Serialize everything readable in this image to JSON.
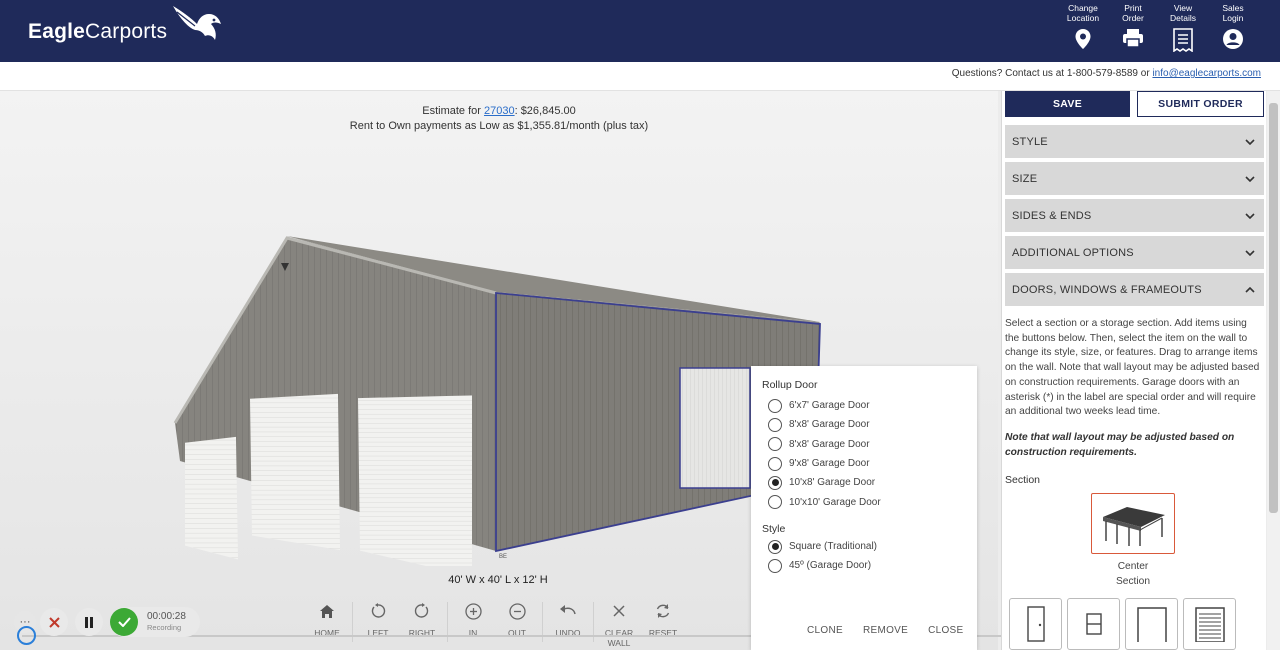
{
  "header": {
    "logo_text_bold": "Eagle",
    "logo_text": "Carports",
    "actions": [
      {
        "label": "Change\nLocation",
        "icon": "location-pin-icon"
      },
      {
        "label": "Print\nOrder",
        "icon": "printer-icon"
      },
      {
        "label": "View\nDetails",
        "icon": "receipt-icon"
      },
      {
        "label": "Sales\nLogin",
        "icon": "user-icon"
      }
    ]
  },
  "contact": {
    "prefix": "Questions? Contact us at 1-800-579-8589 or ",
    "email": "info@eaglecarports.com"
  },
  "viewer": {
    "estimate_prefix": "Estimate for ",
    "zip": "27030",
    "estimate_suffix": ": $26,845.00",
    "rent_line": "Rent to Own payments as Low as $1,355.81/month (plus tax)",
    "dimensions": "40' W x 40' L x 12' H",
    "corner_tag": "BE",
    "toolbar": [
      {
        "label": "HOME",
        "icon": "home-icon"
      },
      {
        "label": "LEFT",
        "icon": "rotate-left-icon"
      },
      {
        "label": "RIGHT",
        "icon": "rotate-right-icon"
      },
      {
        "label": "IN",
        "icon": "zoom-in-icon"
      },
      {
        "label": "OUT",
        "icon": "zoom-out-icon"
      },
      {
        "label": "UNDO",
        "icon": "undo-icon"
      },
      {
        "label": "CLEAR\nWALL",
        "icon": "clear-icon"
      },
      {
        "label": "RESET",
        "icon": "reset-icon"
      }
    ]
  },
  "recorder": {
    "time": "00:00:28",
    "status": "Recording",
    "more": "···"
  },
  "door_popup": {
    "title": "Rollup Door",
    "options": [
      {
        "label": "6'x7' Garage Door",
        "selected": false
      },
      {
        "label": "8'x8' Garage Door",
        "selected": false
      },
      {
        "label": "8'x8' Garage Door",
        "selected": false
      },
      {
        "label": "9'x8' Garage Door",
        "selected": false
      },
      {
        "label": "10'x8' Garage Door",
        "selected": true
      },
      {
        "label": "10'x10' Garage Door",
        "selected": false
      }
    ],
    "style_title": "Style",
    "style_options": [
      {
        "label": "Square (Traditional)",
        "selected": true
      },
      {
        "label": "45º (Garage Door)",
        "selected": false
      }
    ],
    "actions": [
      "CLONE",
      "REMOVE",
      "CLOSE"
    ]
  },
  "panel": {
    "save": "SAVE",
    "submit": "SUBMIT ORDER",
    "accordions": [
      {
        "label": "STYLE",
        "expanded": false
      },
      {
        "label": "SIZE",
        "expanded": false
      },
      {
        "label": "SIDES & ENDS",
        "expanded": false
      },
      {
        "label": "ADDITIONAL OPTIONS",
        "expanded": false
      },
      {
        "label": "DOORS, WINDOWS & FRAMEOUTS",
        "expanded": true
      }
    ],
    "description": "Select a section or a storage section. Add items using the buttons below. Then, select the item on the wall to change its style, size, or features. Drag to arrange items on the wall. Note that wall layout may be adjusted based on construction requirements. Garage doors with an asterisk (*) in the label are special order and will require an additional two weeks lead time.",
    "note": "Note that wall layout may be adjusted based on construction requirements.",
    "section_label": "Section",
    "section_card": {
      "line1": "Center",
      "line2": "Section"
    }
  },
  "colors": {
    "brand_navy": "#1f2a5a",
    "accordion_gray": "#d8d8d8",
    "selected_section_border": "#d9593a",
    "recording_green": "#3ca935"
  }
}
